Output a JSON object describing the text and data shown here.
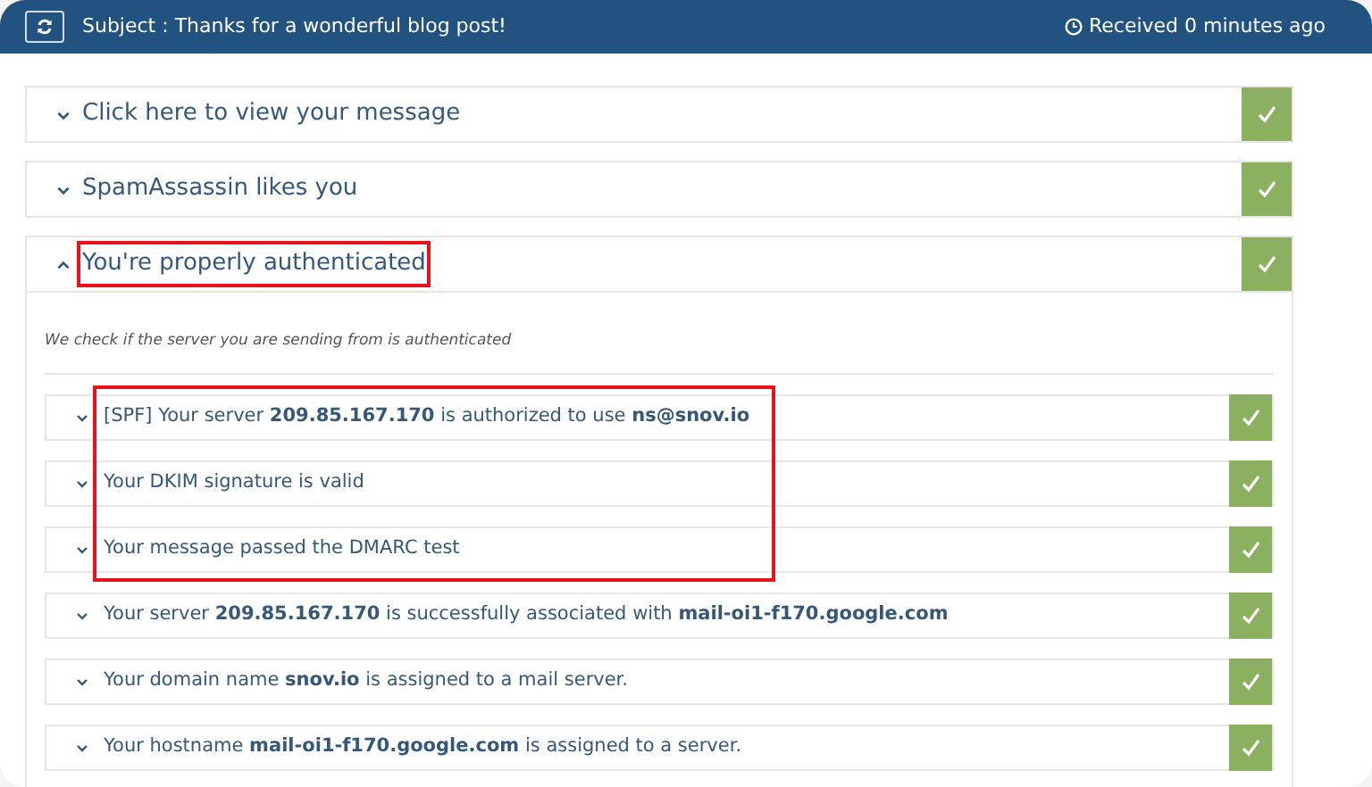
{
  "header": {
    "subject": "Subject : Thanks for a wonderful blog post!",
    "received": "Received 0 minutes ago"
  },
  "sections": [
    {
      "title": "Click here to view your message",
      "expanded": false,
      "passed": true,
      "highlighted": false
    },
    {
      "title": "SpamAssassin likes you",
      "expanded": false,
      "passed": true,
      "highlighted": false
    },
    {
      "title": "You're properly authenticated",
      "expanded": true,
      "passed": true,
      "highlighted": true,
      "description": "We check if the server you are sending from is authenticated",
      "checks": [
        {
          "text": "[SPF] Your server **209.85.167.170** is authorized to use **ns@snov.io**",
          "passed": true,
          "highlighted": true
        },
        {
          "text": "Your DKIM signature is valid",
          "passed": true,
          "highlighted": true
        },
        {
          "text": "Your message passed the DMARC test",
          "passed": true,
          "highlighted": true
        },
        {
          "text": "Your server **209.85.167.170** is successfully associated with **mail-oi1-f170.google.com**",
          "passed": true,
          "highlighted": false
        },
        {
          "text": "Your domain name **snov.io** is assigned to a mail server.",
          "passed": true,
          "highlighted": false
        },
        {
          "text": "Your hostname **mail-oi1-f170.google.com** is assigned to a server.",
          "passed": true,
          "highlighted": false
        }
      ]
    }
  ]
}
